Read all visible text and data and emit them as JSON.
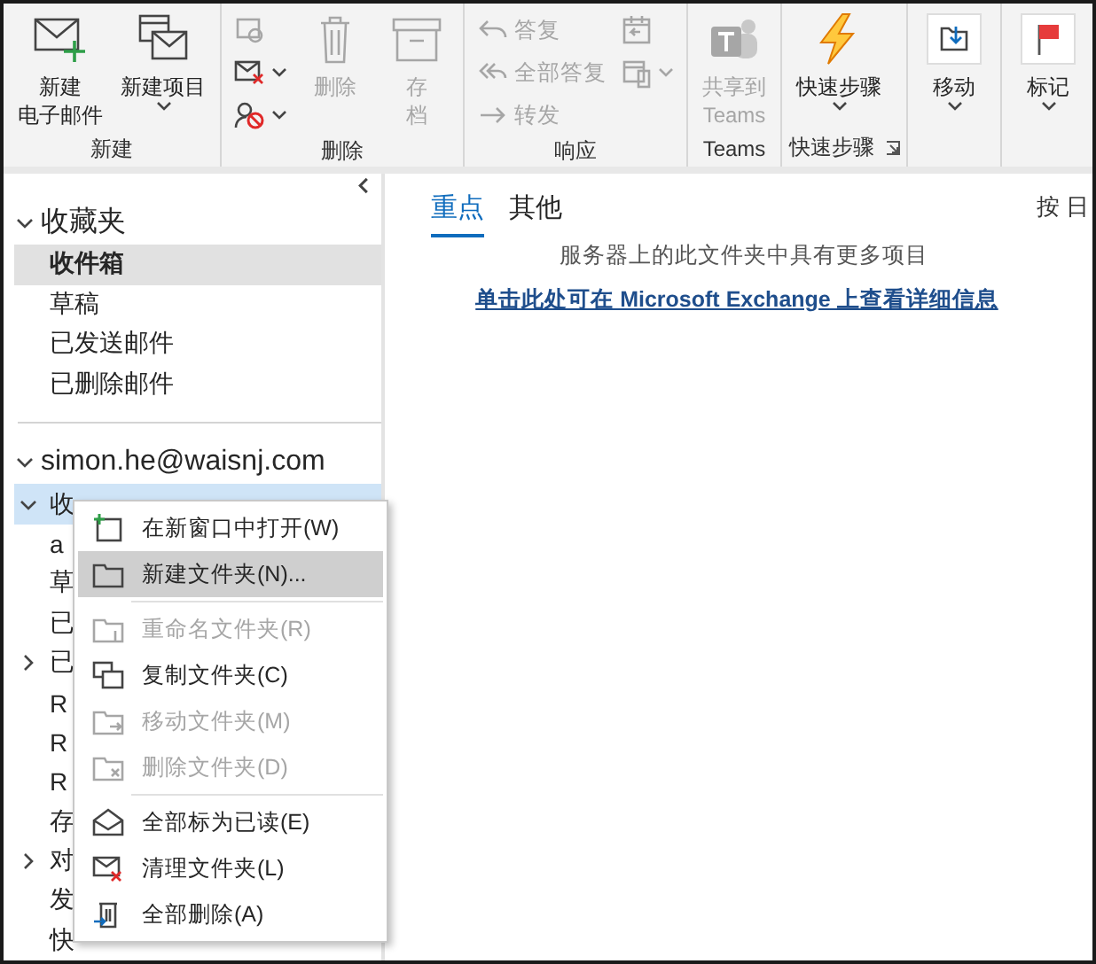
{
  "ribbon": {
    "groups": [
      {
        "label": "新建",
        "controls": [
          {
            "kind": "large",
            "lines": [
              "新建",
              "电子邮件"
            ],
            "disabled": false
          },
          {
            "kind": "large",
            "lines": [
              "新建项目"
            ],
            "disabled": false,
            "dropdown": true
          }
        ]
      },
      {
        "label": "删除",
        "controls": [
          {
            "kind": "stack",
            "items": [
              {
                "disabled": true
              },
              {
                "disabled": false,
                "dropdown": true
              },
              {
                "disabled": false,
                "dropdown": true
              }
            ]
          },
          {
            "kind": "large",
            "lines": [
              "删除"
            ],
            "disabled": true
          },
          {
            "kind": "large",
            "lines": [
              "存",
              "档"
            ],
            "disabled": true
          }
        ]
      },
      {
        "label": "响应",
        "controls": [
          {
            "kind": "stack",
            "items": [
              {
                "label": "答复",
                "disabled": true
              },
              {
                "label": "全部答复",
                "disabled": true
              },
              {
                "label": "转发",
                "disabled": true
              }
            ]
          },
          {
            "kind": "stack",
            "items": [
              {
                "disabled": true
              },
              {
                "disabled": true,
                "dropdown": true
              }
            ]
          }
        ]
      },
      {
        "label": "Teams",
        "controls": [
          {
            "kind": "large",
            "lines": [
              "共享到",
              "Teams"
            ],
            "disabled": true
          }
        ]
      },
      {
        "label": "快速步骤",
        "launcher": true,
        "controls": [
          {
            "kind": "large",
            "lines": [
              "快速步骤"
            ],
            "disabled": false,
            "dropdown": true
          }
        ]
      },
      {
        "controls": [
          {
            "kind": "large",
            "lines": [
              "移动"
            ],
            "disabled": false,
            "dropdown": true
          }
        ]
      },
      {
        "controls": [
          {
            "kind": "large",
            "lines": [
              "标记"
            ],
            "disabled": false,
            "dropdown": true
          }
        ]
      }
    ]
  },
  "sidebar": {
    "sections": [
      {
        "label": "收藏夹",
        "expanded": true,
        "items": [
          {
            "label": "收件箱",
            "selected": true
          },
          {
            "label": "草稿",
            "selected": false
          },
          {
            "label": "已发送邮件",
            "selected": false
          },
          {
            "label": "已删除邮件",
            "selected": false
          }
        ]
      },
      {
        "label": "simon.he@waisnj.com",
        "expanded": true,
        "items": [
          {
            "label": "收",
            "selected": true,
            "expanded": true,
            "children": [
              {
                "label": "a",
                "selected": false
              }
            ]
          },
          {
            "label": "草",
            "selected": false
          },
          {
            "label": "已",
            "selected": false
          },
          {
            "label": "已",
            "selected": false,
            "expanded": false
          },
          {
            "label": "R",
            "selected": false
          },
          {
            "label": "R",
            "selected": false
          },
          {
            "label": "R",
            "selected": false
          },
          {
            "label": "存",
            "selected": false
          },
          {
            "label": "对",
            "selected": false,
            "expanded": false
          },
          {
            "label": "发",
            "selected": false
          },
          {
            "label": "快",
            "selected": false
          }
        ]
      }
    ]
  },
  "main": {
    "tabs": [
      {
        "label": "重点",
        "selected": true
      },
      {
        "label": "其他",
        "selected": false
      }
    ],
    "sort": "按 日",
    "notice": "服务器上的此文件夹中具有更多项目",
    "link": "单击此处可在 Microsoft Exchange 上查看详细信息"
  },
  "context_menu": {
    "items": [
      {
        "kind": "item",
        "label": "在新窗口中打开(W)",
        "disabled": false,
        "selected": false
      },
      {
        "kind": "item",
        "label": "新建文件夹(N)...",
        "disabled": false,
        "selected": true
      },
      {
        "kind": "separator"
      },
      {
        "kind": "item",
        "label": "重命名文件夹(R)",
        "disabled": true,
        "selected": false
      },
      {
        "kind": "item",
        "label": "复制文件夹(C)",
        "disabled": false,
        "selected": false
      },
      {
        "kind": "item",
        "label": "移动文件夹(M)",
        "disabled": true,
        "selected": false
      },
      {
        "kind": "item",
        "label": "删除文件夹(D)",
        "disabled": true,
        "selected": false
      },
      {
        "kind": "separator"
      },
      {
        "kind": "item",
        "label": "全部标为已读(E)",
        "disabled": false,
        "selected": false
      },
      {
        "kind": "item",
        "label": "清理文件夹(L)",
        "disabled": false,
        "selected": false
      },
      {
        "kind": "item",
        "label": "全部删除(A)",
        "disabled": false,
        "selected": false
      }
    ]
  }
}
